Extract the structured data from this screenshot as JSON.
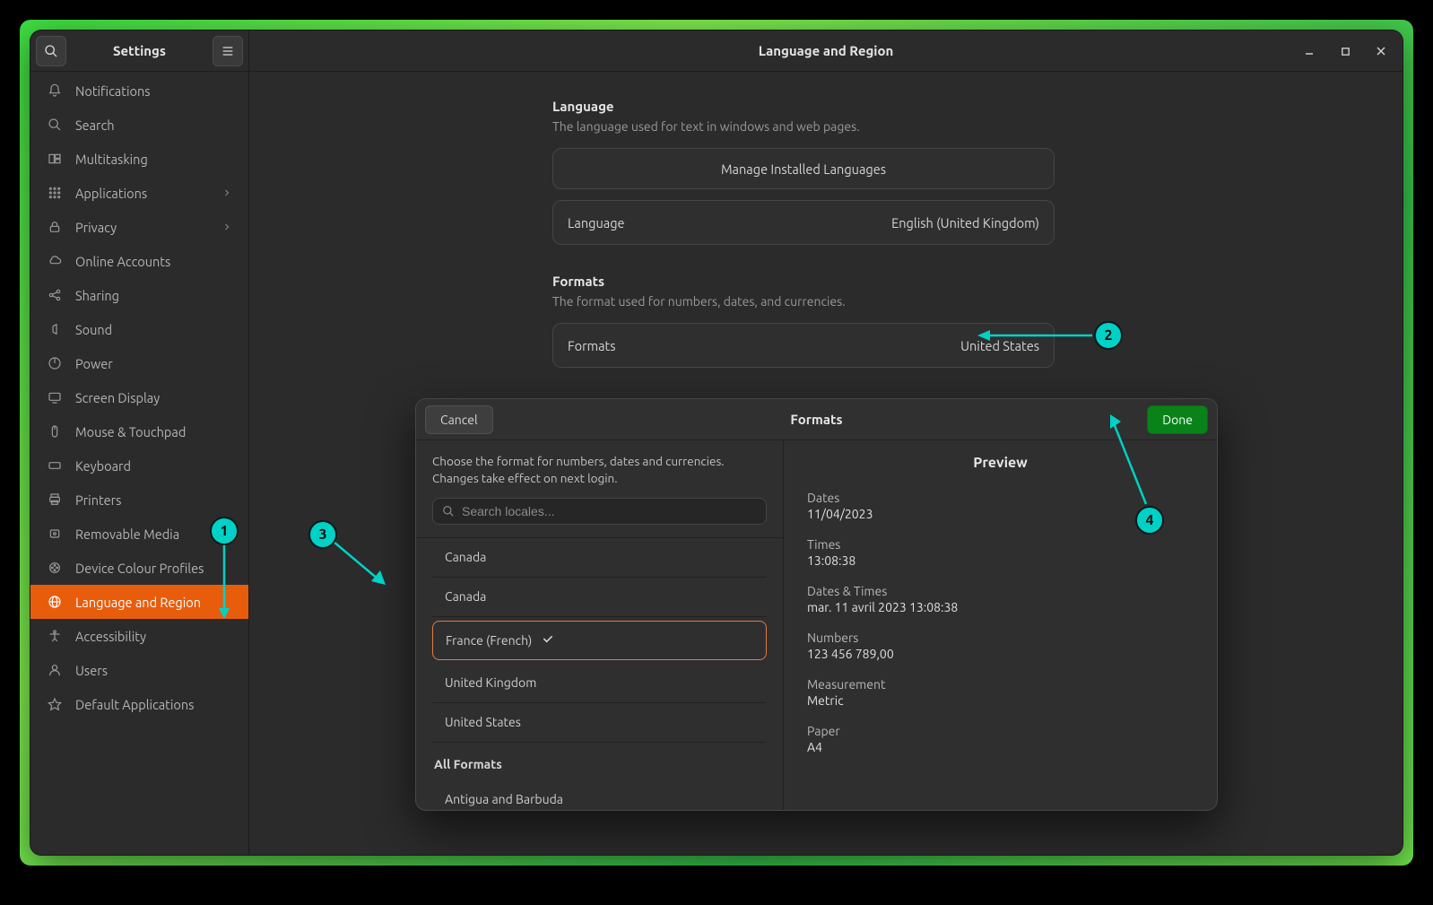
{
  "sidebar": {
    "title": "Settings",
    "items": [
      {
        "label": "Notifications",
        "icon": "bell-icon"
      },
      {
        "label": "Search",
        "icon": "search-icon"
      },
      {
        "label": "Multitasking",
        "icon": "multitask-icon"
      },
      {
        "label": "Applications",
        "icon": "apps-icon",
        "chevron": true
      },
      {
        "label": "Privacy",
        "icon": "lock-icon",
        "chevron": true
      },
      {
        "label": "Online Accounts",
        "icon": "cloud-icon"
      },
      {
        "label": "Sharing",
        "icon": "share-icon"
      },
      {
        "label": "Sound",
        "icon": "sound-icon"
      },
      {
        "label": "Power",
        "icon": "power-icon"
      },
      {
        "label": "Screen Display",
        "icon": "display-icon"
      },
      {
        "label": "Mouse & Touchpad",
        "icon": "mouse-icon"
      },
      {
        "label": "Keyboard",
        "icon": "keyboard-icon"
      },
      {
        "label": "Printers",
        "icon": "printer-icon"
      },
      {
        "label": "Removable Media",
        "icon": "media-icon"
      },
      {
        "label": "Device Colour Profiles",
        "icon": "color-icon"
      },
      {
        "label": "Language and Region",
        "icon": "globe-icon",
        "active": true
      },
      {
        "label": "Accessibility",
        "icon": "accessibility-icon"
      },
      {
        "label": "Users",
        "icon": "users-icon"
      },
      {
        "label": "Default Applications",
        "icon": "star-icon"
      }
    ]
  },
  "header": {
    "title": "Language and Region"
  },
  "language_section": {
    "title": "Language",
    "desc": "The language used for text in windows and web pages.",
    "manage_button": "Manage Installed Languages",
    "row_label": "Language",
    "row_value": "English (United Kingdom)"
  },
  "formats_section": {
    "title": "Formats",
    "desc": "The format used for numbers, dates, and currencies.",
    "row_label": "Formats",
    "row_value": "United States"
  },
  "dialog": {
    "title": "Formats",
    "cancel": "Cancel",
    "done": "Done",
    "instruction": "Choose the format for numbers, dates and currencies. Changes take effect on next login.",
    "search_placeholder": "Search locales...",
    "common": [
      {
        "label": "Canada"
      },
      {
        "label": "Canada"
      },
      {
        "label": "France (French)",
        "selected": true
      },
      {
        "label": "United Kingdom"
      },
      {
        "label": "United States"
      }
    ],
    "all_heading": "All Formats",
    "all": [
      {
        "label": "Antigua and Barbuda"
      }
    ],
    "preview": {
      "title": "Preview",
      "fields": [
        {
          "label": "Dates",
          "value": "11/04/2023"
        },
        {
          "label": "Times",
          "value": "13:08:38"
        },
        {
          "label": "Dates & Times",
          "value": "mar. 11 avril 2023 13:08:38"
        },
        {
          "label": "Numbers",
          "value": "123 456 789,00"
        },
        {
          "label": "Measurement",
          "value": "Metric"
        },
        {
          "label": "Paper",
          "value": "A4"
        }
      ]
    }
  },
  "annotations": {
    "1": "1",
    "2": "2",
    "3": "3",
    "4": "4"
  }
}
